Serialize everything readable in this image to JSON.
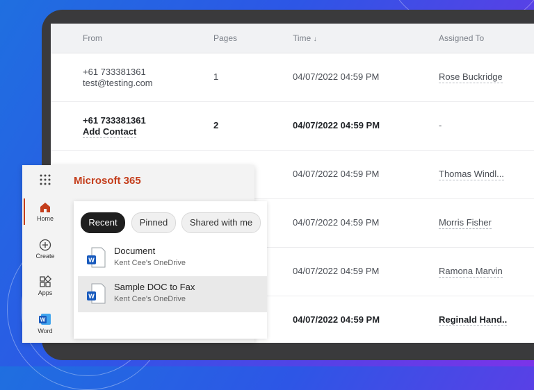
{
  "table": {
    "headers": [
      "From",
      "Pages",
      "Time",
      "Assigned To"
    ],
    "sort_glyph": "↓",
    "rows": [
      {
        "from_line1": "+61 733381361",
        "from_line2": "test@testing.com",
        "pages": "1",
        "time": "04/07/2022 04:59 PM",
        "assigned": "Rose Buckridge",
        "unread": false
      },
      {
        "from_line1": "+61 733381361",
        "from_line2": "Add Contact",
        "pages": "2",
        "time": "04/07/2022 04:59 PM",
        "assigned": "-",
        "unread": true
      },
      {
        "from_line1": "",
        "from_line2": "",
        "pages": "",
        "time": "04/07/2022 04:59 PM",
        "assigned": "Thomas Windl...",
        "unread": false
      },
      {
        "from_line1": "",
        "from_line2": "",
        "pages": "",
        "time": "04/07/2022 04:59 PM",
        "assigned": "Morris Fisher",
        "unread": false
      },
      {
        "from_line1": "",
        "from_line2": "",
        "pages": "",
        "time": "04/07/2022 04:59 PM",
        "assigned": "Ramona Marvin",
        "unread": false
      },
      {
        "from_line1": "",
        "from_line2": "",
        "pages": "",
        "time": "04/07/2022 04:59 PM",
        "assigned": "Reginald Hand..",
        "unread": true
      }
    ]
  },
  "m365": {
    "title": "Microsoft 365",
    "brand_color": "#c43e1c",
    "rail": [
      {
        "label": "Home",
        "icon": "home-icon"
      },
      {
        "label": "Create",
        "icon": "plus-circle-icon"
      },
      {
        "label": "Apps",
        "icon": "apps-icon"
      },
      {
        "label": "Word",
        "icon": "word-icon"
      }
    ],
    "tabs": [
      "Recent",
      "Pinned",
      "Shared with me"
    ],
    "active_tab": "Recent",
    "documents": [
      {
        "title": "Document",
        "location": "Kent Cee's OneDrive",
        "icon": "word-doc-icon"
      },
      {
        "title": "Sample DOC to Fax",
        "location": "Kent Cee's OneDrive",
        "icon": "word-doc-icon"
      }
    ]
  }
}
